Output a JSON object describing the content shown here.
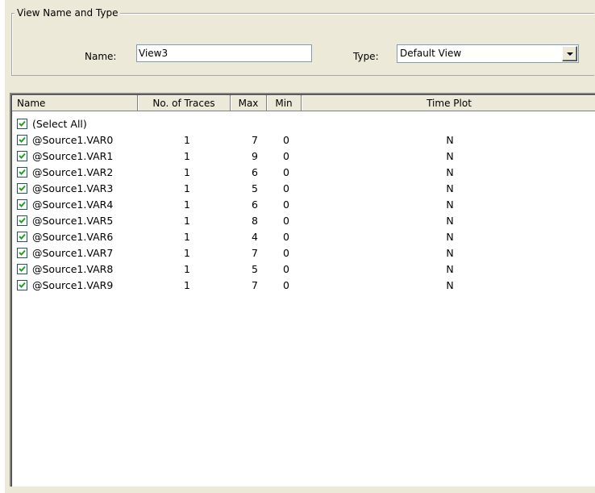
{
  "group": {
    "title": "View Name and Type"
  },
  "name_field": {
    "label": "Name:",
    "value": "View3"
  },
  "type_field": {
    "label": "Type:",
    "value": "Default View"
  },
  "list": {
    "columns": [
      "Name",
      "No. of Traces",
      "Max",
      "Min",
      "Time Plot"
    ],
    "select_all": "(Select All)",
    "rows": [
      {
        "name": "@Source1.VAR0",
        "traces": "1",
        "max": "7",
        "min": "0",
        "time_plot": "N"
      },
      {
        "name": "@Source1.VAR1",
        "traces": "1",
        "max": "9",
        "min": "0",
        "time_plot": "N"
      },
      {
        "name": "@Source1.VAR2",
        "traces": "1",
        "max": "6",
        "min": "0",
        "time_plot": "N"
      },
      {
        "name": "@Source1.VAR3",
        "traces": "1",
        "max": "5",
        "min": "0",
        "time_plot": "N"
      },
      {
        "name": "@Source1.VAR4",
        "traces": "1",
        "max": "6",
        "min": "0",
        "time_plot": "N"
      },
      {
        "name": "@Source1.VAR5",
        "traces": "1",
        "max": "8",
        "min": "0",
        "time_plot": "N"
      },
      {
        "name": "@Source1.VAR6",
        "traces": "1",
        "max": "4",
        "min": "0",
        "time_plot": "N"
      },
      {
        "name": "@Source1.VAR7",
        "traces": "1",
        "max": "7",
        "min": "0",
        "time_plot": "N"
      },
      {
        "name": "@Source1.VAR8",
        "traces": "1",
        "max": "5",
        "min": "0",
        "time_plot": "N"
      },
      {
        "name": "@Source1.VAR9",
        "traces": "1",
        "max": "7",
        "min": "0",
        "time_plot": "N"
      }
    ]
  },
  "colors": {
    "panel": "#ece9d8",
    "checkmark": "#21a121",
    "checkbox_border": "#1c5180"
  },
  "icons": {
    "checkbox": "checkbox-checked-icon",
    "dropdown": "chevron-down-icon"
  }
}
